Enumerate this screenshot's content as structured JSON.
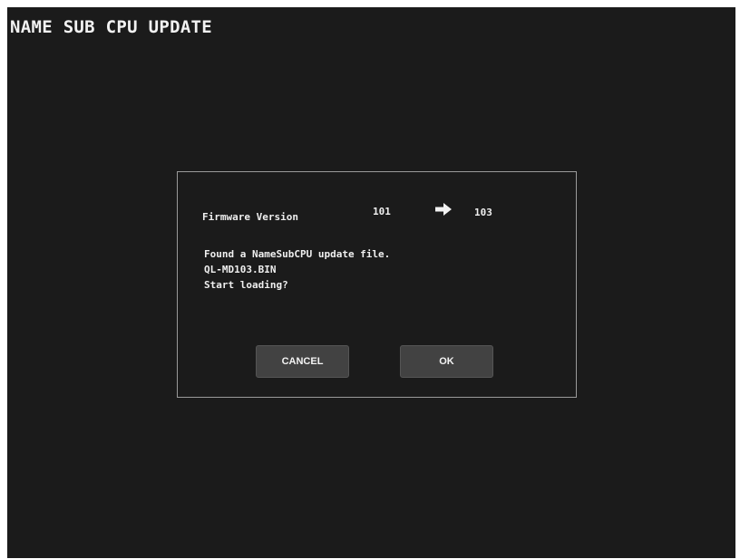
{
  "page": {
    "title": "NAME SUB CPU UPDATE"
  },
  "dialog": {
    "firmware_label": "Firmware Version",
    "current_version": "101",
    "arrow_icon": "right-arrow-icon",
    "new_version": "103",
    "message_lines": [
      "Found a NameSubCPU update file.",
      "QL-MD103.BIN",
      "Start loading?"
    ],
    "cancel_label": "CANCEL",
    "ok_label": "OK"
  },
  "colors": {
    "background": "#1b1b1b",
    "text": "#efefef",
    "button": "#424242",
    "dialog_border": "#9a9a9a"
  }
}
